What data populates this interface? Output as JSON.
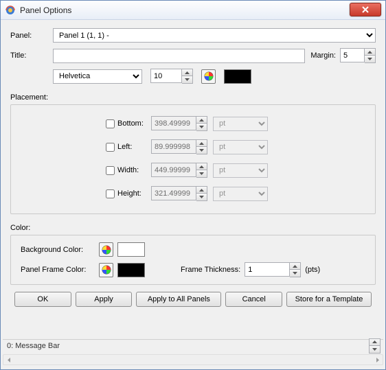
{
  "window": {
    "title": "Panel Options"
  },
  "panel": {
    "label": "Panel:",
    "selected": "Panel 1 (1, 1)  -"
  },
  "title": {
    "label": "Title:",
    "value": "",
    "marginLabel": "Margin:",
    "marginValue": "5",
    "font": "Helvetica",
    "fontSize": "10",
    "colorSwatch": "#000000"
  },
  "placement": {
    "label": "Placement:",
    "rows": [
      {
        "label": "Bottom:",
        "value": "398.49999",
        "unit": "pt"
      },
      {
        "label": "Left:",
        "value": "89.999998",
        "unit": "pt"
      },
      {
        "label": "Width:",
        "value": "449.99999",
        "unit": "pt"
      },
      {
        "label": "Height:",
        "value": "321.49999",
        "unit": "pt"
      }
    ]
  },
  "color": {
    "label": "Color:",
    "bgLabel": "Background Color:",
    "bgSwatch": "#ffffff",
    "frameLabel": "Panel Frame Color:",
    "frameSwatch": "#000000",
    "thicknessLabel": "Frame Thickness:",
    "thicknessValue": "1",
    "thicknessUnit": "(pts)"
  },
  "buttons": {
    "ok": "OK",
    "apply": "Apply",
    "applyAll": "Apply to All Panels",
    "cancel": "Cancel",
    "store": "Store for a Template"
  },
  "messageBar": "0: Message Bar"
}
